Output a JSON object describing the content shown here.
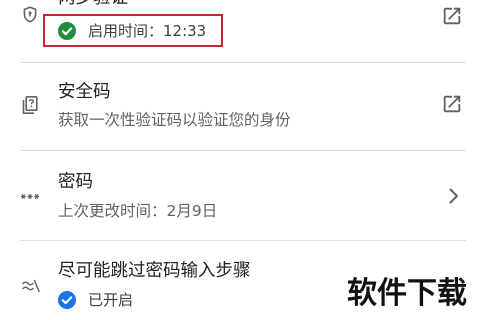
{
  "security_list": {
    "rows": [
      {
        "title": "两步验证",
        "status_text": "启用时间：12:33",
        "status_icon": "check-circle-icon",
        "icon": "shield-icon",
        "action_icon": "external-link-icon",
        "highlighted": true
      },
      {
        "title": "安全码",
        "subtitle": "获取一次性验证码以验证您的身份",
        "icon": "backup-codes-icon",
        "action_icon": "external-link-icon"
      },
      {
        "title": "密码",
        "subtitle": "上次更改时间：2月9日",
        "icon": "password-icon",
        "action_icon": "chevron-right-icon"
      },
      {
        "title": "尽可能跳过密码输入步骤",
        "status_text": "已开启",
        "status_icon": "check-circle-icon",
        "icon": "skip-password-icon"
      }
    ]
  },
  "watermark": {
    "text": "软件下载"
  },
  "colors": {
    "background": "#ffffff",
    "title_text": "#202124",
    "subtitle_text": "#5f6368",
    "status_text": "#3c4043",
    "icon": "#5f6368",
    "divider": "#e0e0e0",
    "check_green": "#1e8e3e",
    "check_blue": "#1a73e8",
    "highlight_box": "#c0282d",
    "watermark": "#111111"
  }
}
